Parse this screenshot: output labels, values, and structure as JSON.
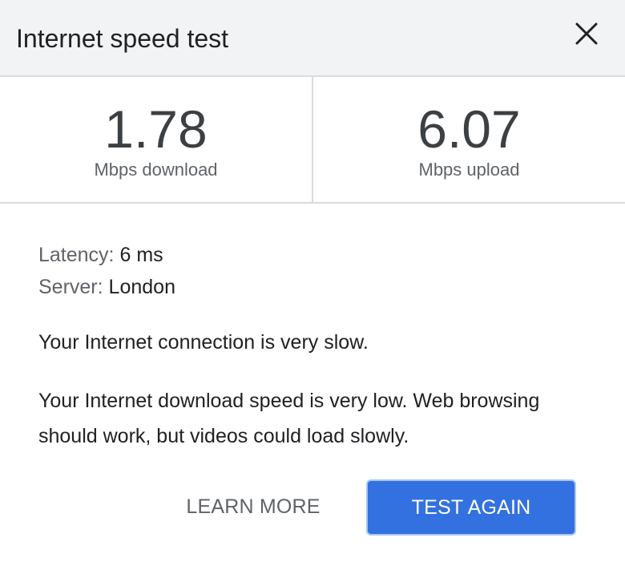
{
  "header": {
    "title": "Internet speed test",
    "close_icon": "close-icon"
  },
  "stats": {
    "download": {
      "value": "1.78",
      "label": "Mbps download"
    },
    "upload": {
      "value": "6.07",
      "label": "Mbps upload"
    }
  },
  "details": {
    "latency_key": "Latency:",
    "latency_value": "6 ms",
    "server_key": "Server:",
    "server_value": "London"
  },
  "messages": {
    "summary": "Your Internet connection is very slow.",
    "explanation": "Your Internet download speed is very low. Web browsing should work, but videos could load slowly."
  },
  "actions": {
    "learn_more": "LEARN MORE",
    "test_again": "TEST AGAIN"
  },
  "colors": {
    "header_bg": "#f1f3f4",
    "divider": "#dadce0",
    "primary": "#3371e0",
    "text": "#202124",
    "muted": "#5f6368"
  }
}
